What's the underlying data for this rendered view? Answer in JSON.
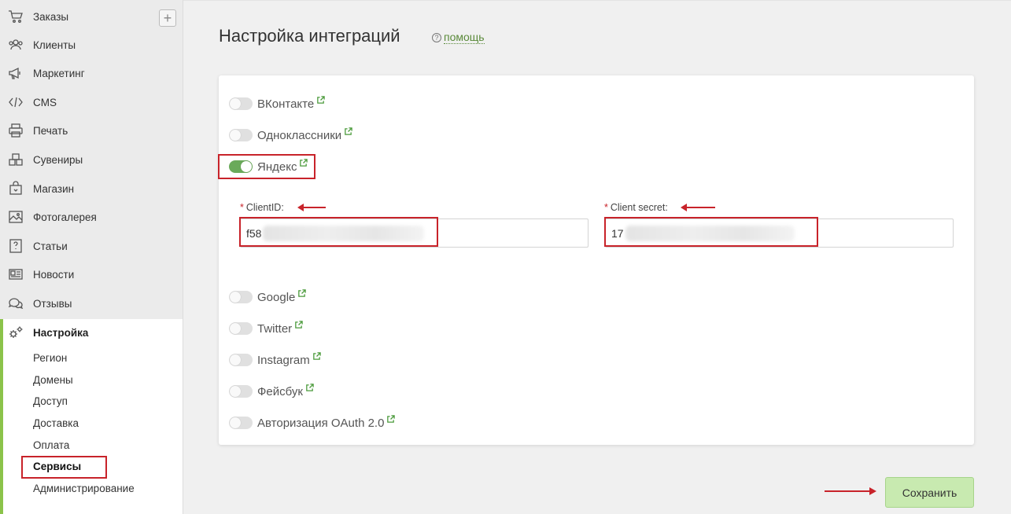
{
  "sidebar": {
    "items": [
      {
        "label": "Заказы",
        "icon": "cart-icon"
      },
      {
        "label": "Клиенты",
        "icon": "users-icon"
      },
      {
        "label": "Маркетинг",
        "icon": "megaphone-icon"
      },
      {
        "label": "CMS",
        "icon": "code-icon"
      },
      {
        "label": "Печать",
        "icon": "printer-icon"
      },
      {
        "label": "Сувениры",
        "icon": "boxes-icon"
      },
      {
        "label": "Магазин",
        "icon": "shop-bag-icon"
      },
      {
        "label": "Фотогалерея",
        "icon": "photo-icon"
      },
      {
        "label": "Статьи",
        "icon": "article-icon"
      },
      {
        "label": "Новости",
        "icon": "news-icon"
      },
      {
        "label": "Отзывы",
        "icon": "chat-icon"
      },
      {
        "label": "Настройка",
        "icon": "gears-icon"
      }
    ],
    "add_label": "+",
    "sub_items": [
      "Регион",
      "Домены",
      "Доступ",
      "Доставка",
      "Оплата",
      "Сервисы",
      "Администрирование"
    ],
    "current_sub": "Сервисы"
  },
  "page": {
    "title": "Настройка интеграций",
    "help_label": "помощь"
  },
  "integrations": [
    {
      "name": "ВКонтакте",
      "enabled": false
    },
    {
      "name": "Одноклассники",
      "enabled": false
    },
    {
      "name": "Яндекс",
      "enabled": true
    },
    {
      "name": "Google",
      "enabled": false
    },
    {
      "name": "Twitter",
      "enabled": false
    },
    {
      "name": "Instagram",
      "enabled": false
    },
    {
      "name": "Фейсбук",
      "enabled": false
    },
    {
      "name": "Авторизация OAuth 2.0",
      "enabled": false
    }
  ],
  "yandex_fields": {
    "client_id_label": "ClientID:",
    "client_id_value": "f58",
    "client_secret_label": "Client secret:",
    "client_secret_value": "17",
    "required_mark": "*"
  },
  "actions": {
    "save_label": "Сохранить"
  },
  "colors": {
    "accent": "#8bc34a",
    "toggle_on": "#6aaa5a",
    "highlight": "#c8232a",
    "save_bg": "#c8eab0"
  }
}
